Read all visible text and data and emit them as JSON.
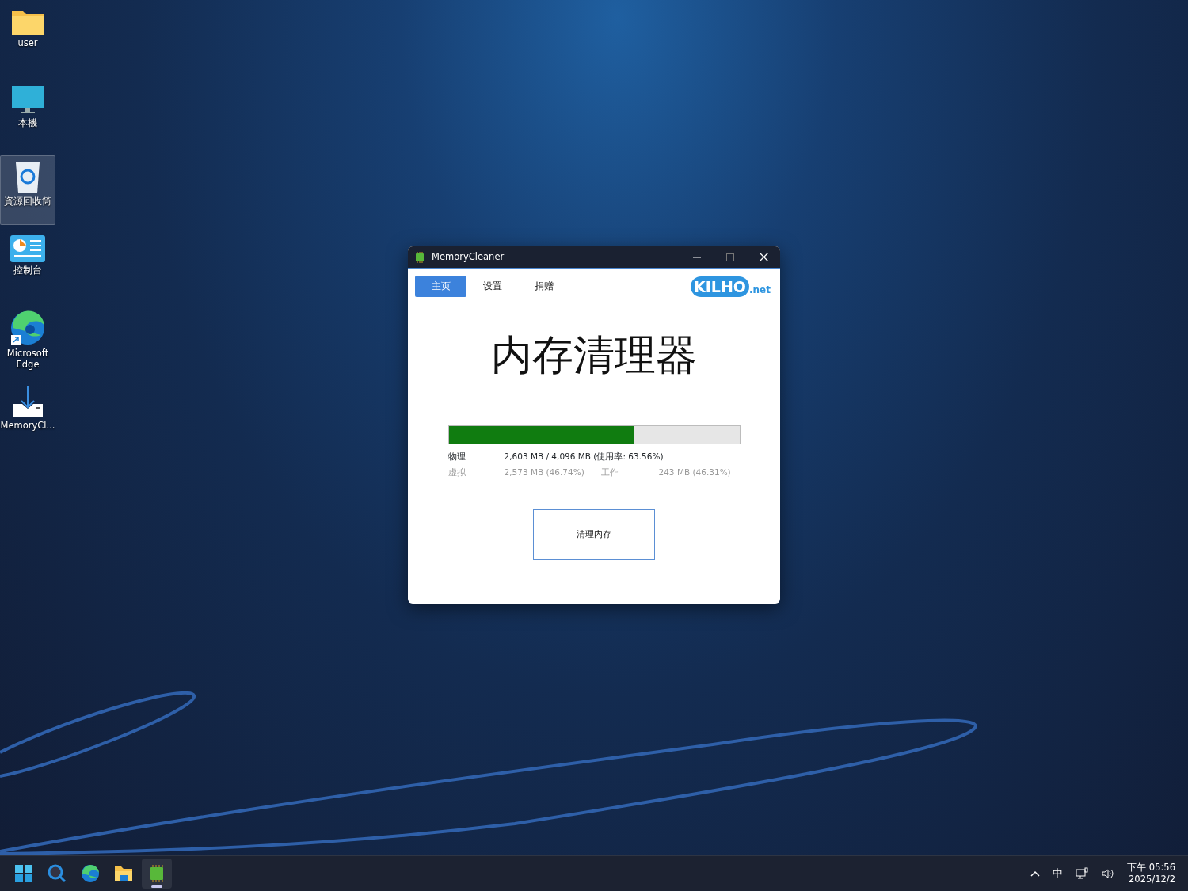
{
  "desktop_icons": [
    {
      "label": "user",
      "kind": "folder",
      "selected": false
    },
    {
      "label": "本機",
      "kind": "computer",
      "selected": false
    },
    {
      "label": "資源回收筒",
      "kind": "recycle-bin",
      "selected": true
    },
    {
      "label": "控制台",
      "kind": "control-panel",
      "selected": false
    },
    {
      "label": "Microsoft Edge",
      "kind": "edge",
      "selected": false
    },
    {
      "label": "MemoryCl...",
      "kind": "installer",
      "selected": false
    }
  ],
  "window": {
    "title": "MemoryCleaner",
    "tabs": [
      {
        "label": "主页",
        "selected": true
      },
      {
        "label": "设置",
        "selected": false
      },
      {
        "label": "捐赠",
        "selected": false
      }
    ],
    "logo": {
      "main": "KILHO",
      "suffix": ".net"
    },
    "heading": "内存清理器",
    "meter": {
      "level": 0.6356
    },
    "stats": [
      {
        "muted": false,
        "cells": [
          "物理",
          "2,603 MB / 4,096 MB (使用率: 63.56%)"
        ]
      },
      {
        "muted": true,
        "cells": [
          "虚拟",
          "2,573 MB (46.74%)",
          "工作",
          "243 MB (46.31%)"
        ]
      }
    ],
    "button": "清理内存"
  },
  "taskbar": {
    "apps": [
      {
        "kind": "start",
        "active": false
      },
      {
        "kind": "search",
        "active": false
      },
      {
        "kind": "edge",
        "active": false
      },
      {
        "kind": "explorer",
        "active": false
      },
      {
        "kind": "memory-chip",
        "active": true
      }
    ],
    "tray": {
      "ime": "中",
      "time": "下午 05:56",
      "date": "2025/12/2"
    }
  }
}
